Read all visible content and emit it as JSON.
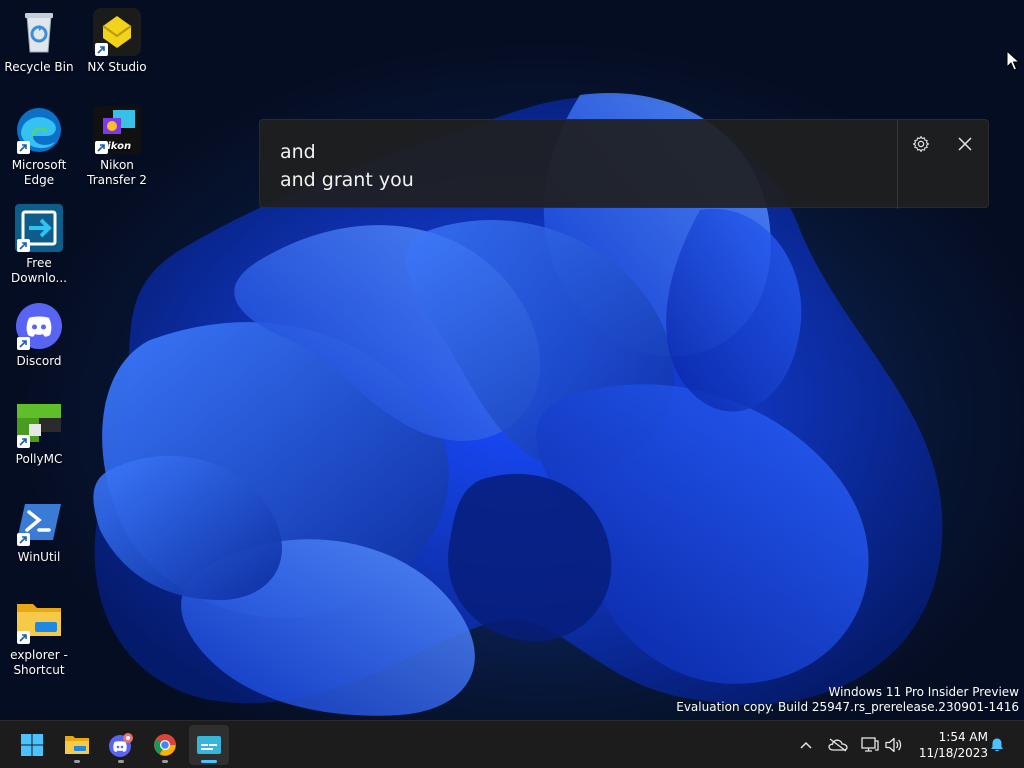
{
  "desktop": {
    "icons": [
      {
        "label": "Recycle Bin",
        "icon": "recycle-bin-icon"
      },
      {
        "label": "NX Studio",
        "icon": "nx-studio-icon"
      },
      {
        "label": "Microsoft Edge",
        "icon": "edge-icon"
      },
      {
        "label": "Nikon Transfer 2",
        "icon": "nikon-transfer-icon"
      },
      {
        "label": "Free Downlo...",
        "icon": "free-download-manager-icon"
      },
      {
        "label": "Discord",
        "icon": "discord-icon"
      },
      {
        "label": "PollyMC",
        "icon": "pollymc-icon"
      },
      {
        "label": "WinUtil",
        "icon": "powershell-icon"
      },
      {
        "label": "explorer - Shortcut",
        "icon": "folder-icon"
      }
    ]
  },
  "live_captions": {
    "line1": "and",
    "line2": "and grant you",
    "settings_icon": "gear-icon",
    "close_icon": "close-icon"
  },
  "watermark": {
    "line1": "Windows 11 Pro Insider Preview",
    "line2": "Evaluation copy. Build 25947.rs_prerelease.230901-1416"
  },
  "taskbar": {
    "apps": [
      {
        "name": "start",
        "icon": "windows-logo-icon"
      },
      {
        "name": "file-explorer",
        "icon": "folder-icon"
      },
      {
        "name": "discord",
        "icon": "discord-icon"
      },
      {
        "name": "chrome",
        "icon": "chrome-icon"
      },
      {
        "name": "live-captions",
        "icon": "live-captions-icon"
      }
    ],
    "tray": {
      "icons": [
        "chevron-up-icon",
        "onedrive-icon",
        "network-icon",
        "volume-icon"
      ],
      "time": "1:54 AM",
      "date": "11/18/2023",
      "notification_icon": "bell-icon"
    }
  },
  "colors": {
    "accent": "#4cc2ff",
    "taskbar_bg": "#1c1c1c",
    "caption_bg": "#202020"
  }
}
